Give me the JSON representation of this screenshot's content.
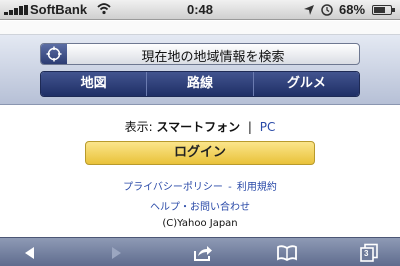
{
  "status_bar": {
    "carrier": "SoftBank",
    "time": "0:48",
    "battery_percent": "68%",
    "battery_level": 0.68
  },
  "search": {
    "label": "現在地の地域情報を検索"
  },
  "tabs": [
    {
      "label": "地図"
    },
    {
      "label": "路線"
    },
    {
      "label": "グルメ"
    }
  ],
  "display": {
    "prefix": "表示:",
    "current_mode": "スマートフォン",
    "separator": "|",
    "alt_mode": "PC"
  },
  "login": {
    "label": "ログイン"
  },
  "links": {
    "privacy": "プライバシーポリシー",
    "dash": "-",
    "terms": "利用規約",
    "help": "ヘルプ・お問い合わせ"
  },
  "copyright": "(C)Yahoo Japan",
  "toolbar": {
    "tab_count": "3"
  },
  "colors": {
    "nav_blue": "#2d3d73",
    "login_yellow": "#f3d461",
    "link_blue": "#2a4aa8"
  }
}
